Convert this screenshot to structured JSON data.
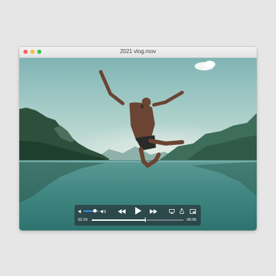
{
  "window": {
    "title": "2021 vlog.mov",
    "traffic_lights": [
      "close",
      "minimize",
      "zoom"
    ]
  },
  "player": {
    "elapsed": "02:29",
    "remaining": "-00:56",
    "progress": 0.58,
    "volume": 0.72,
    "controls": {
      "mute_icon": "speaker-low-icon",
      "volume_max_icon": "speaker-high-icon",
      "rewind_icon": "rewind-icon",
      "play_icon": "play-icon",
      "forward_icon": "fast-forward-icon",
      "airplay_icon": "airplay-icon",
      "share_icon": "share-icon",
      "pip_icon": "picture-in-picture-icon"
    },
    "accent_color": "#3d8fe0"
  }
}
